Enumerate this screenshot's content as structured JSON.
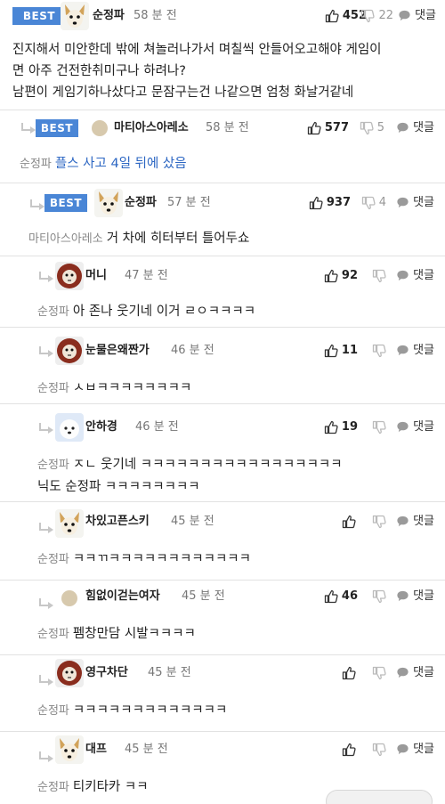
{
  "best_label": "BEST",
  "reply_label": "댓글",
  "comments": [
    {
      "nick": "순정파",
      "time": "58 분 전",
      "up": "452",
      "down": "22",
      "lines": [
        "진지해서 미안한데 밖에 쳐놀러나가서 며칠씩 안들어오고해야 게임이",
        "면 아주 건전한취미구나 하려나?",
        "남편이 게임기하나샀다고 문잠구는건 나같으면 엄청 화날거같네"
      ]
    },
    {
      "nick": "마티아스아레소",
      "time": "58 분 전",
      "up": "577",
      "down": "5",
      "mention": "순정파",
      "text": "플스 사고 4일 뒤에 샀음"
    },
    {
      "nick": "순정파",
      "time": "57 분 전",
      "up": "937",
      "down": "4",
      "mention": "마티아스아레소",
      "text": "거 차에 히터부터 틀어두쇼"
    },
    {
      "nick": "머니",
      "time": "47 분 전",
      "up": "92",
      "down": "",
      "mention": "순정파",
      "text": "아 존나 웃기네 이거 ㄹㅇㅋㅋㅋㅋ"
    },
    {
      "nick": "눈물은왜짠가",
      "time": "46 분 전",
      "up": "11",
      "down": "",
      "mention": "순정파",
      "text": "ㅅㅂㅋㅋㅋㅋㅋㅋㅋㅋ"
    },
    {
      "nick": "안하경",
      "time": "46 분 전",
      "up": "19",
      "down": "",
      "mention": "순정파",
      "line1": "ㅈㄴ 웃기네 ㅋㅋㅋㅋㅋㅋㅋㅋㅋㅋㅋㅋㅋㅋㅋㅋㅋ",
      "line2": "닉도 순정파 ㅋㅋㅋㅋㅋㅋㅋㅋ"
    },
    {
      "nick": "차있고픈스키",
      "time": "45 분 전",
      "up": "",
      "down": "",
      "mention": "순정파",
      "text": "ㅋㅋㄲㅋㅋㅋㅋㅋㅋㅋㅋㅋㅋㅋㅋ"
    },
    {
      "nick": "힘없이걷는여자",
      "time": "45 분 전",
      "up": "46",
      "down": "",
      "mention": "순정파",
      "text": "펨창만담 시발ㅋㅋㅋㅋ"
    },
    {
      "nick": "영구차단",
      "time": "45 분 전",
      "up": "",
      "down": "",
      "mention": "순정파",
      "text": "ㅋㅋㅋㅋㅋㅋㅋㅋㅋㅋㅋㅋㅋ"
    },
    {
      "nick": "대프",
      "time": "45 분 전",
      "up": "",
      "down": "",
      "mention": "순정파",
      "text": "티키타카 ㅋㅋ"
    }
  ]
}
